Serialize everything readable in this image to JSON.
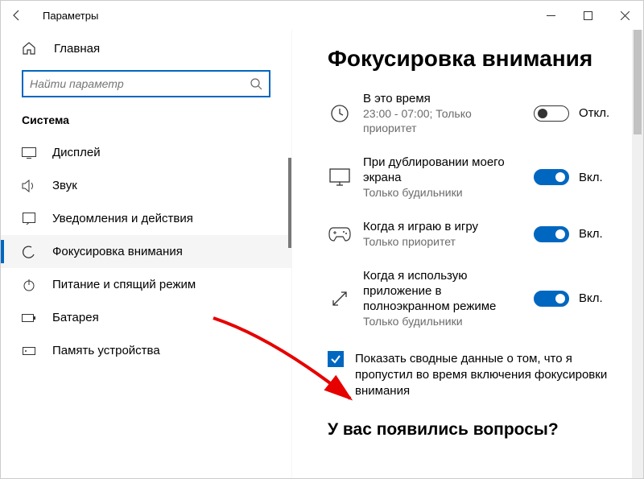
{
  "window": {
    "title": "Параметры"
  },
  "home": {
    "label": "Главная"
  },
  "search": {
    "placeholder": "Найти параметр"
  },
  "group": {
    "label": "Система"
  },
  "nav": {
    "items": [
      {
        "label": "Дисплей"
      },
      {
        "label": "Звук"
      },
      {
        "label": "Уведомления и действия"
      },
      {
        "label": "Фокусировка внимания"
      },
      {
        "label": "Питание и спящий режим"
      },
      {
        "label": "Батарея"
      },
      {
        "label": "Память устройства"
      }
    ]
  },
  "content": {
    "heading": "Фокусировка внимания",
    "rules": [
      {
        "title": "В это время",
        "sub": "23:00 - 07:00; Только приоритет",
        "state_label": "Откл.",
        "on": false
      },
      {
        "title": "При дублировании моего экрана",
        "sub": "Только будильники",
        "state_label": "Вкл.",
        "on": true
      },
      {
        "title": "Когда я играю в игру",
        "sub": "Только приоритет",
        "state_label": "Вкл.",
        "on": true
      },
      {
        "title": "Когда я использую приложение в полноэкранном режиме",
        "sub": "Только будильники",
        "state_label": "Вкл.",
        "on": true
      }
    ],
    "checkbox_label": "Показать сводные данные о том, что я пропустил во время включения фокусировки внимания",
    "subheading": "У вас появились вопросы?"
  }
}
